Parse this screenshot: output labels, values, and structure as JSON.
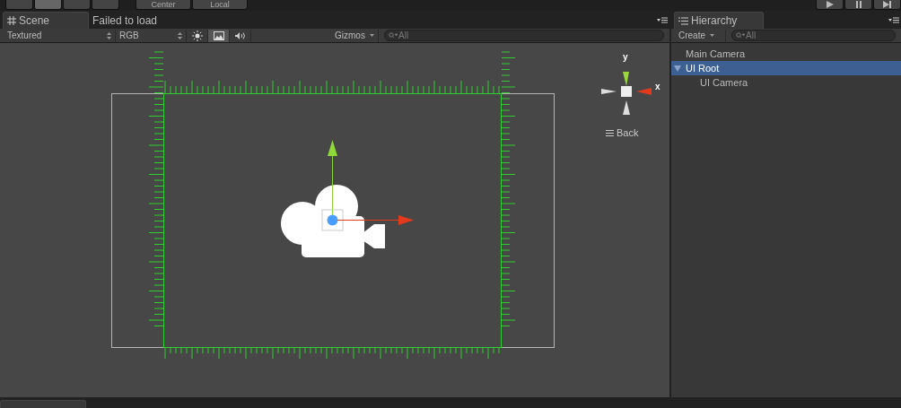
{
  "toolbar": {
    "pivot_buttons": [
      {
        "label": "Center"
      },
      {
        "label": "Local"
      }
    ],
    "play_buttons": [
      {
        "kind": "play"
      },
      {
        "kind": "pause"
      },
      {
        "kind": "step"
      }
    ]
  },
  "scene_tabs": [
    {
      "label": "Scene",
      "selected": true
    },
    {
      "label": "Failed to load",
      "selected": false
    }
  ],
  "scene_toolbar": {
    "render_mode": "Textured",
    "channel": "RGB",
    "lighting": {
      "on": false
    },
    "skybox": {
      "on": true
    },
    "audio": {
      "on": false
    },
    "gizmos": "Gizmos",
    "search": {
      "placeholder": "All"
    }
  },
  "orientation_gizmo": {
    "y_label": "y",
    "x_label": "x",
    "view_label": "Back"
  },
  "hierarchy": {
    "tab": "Hierarchy",
    "create": "Create",
    "search": {
      "placeholder": "All"
    },
    "items": [
      {
        "label": "Main Camera",
        "selected": false
      },
      {
        "label": "UI Root",
        "selected": true,
        "expanded": true,
        "children": [
          {
            "label": "UI Camera",
            "selected": false
          }
        ]
      }
    ]
  }
}
